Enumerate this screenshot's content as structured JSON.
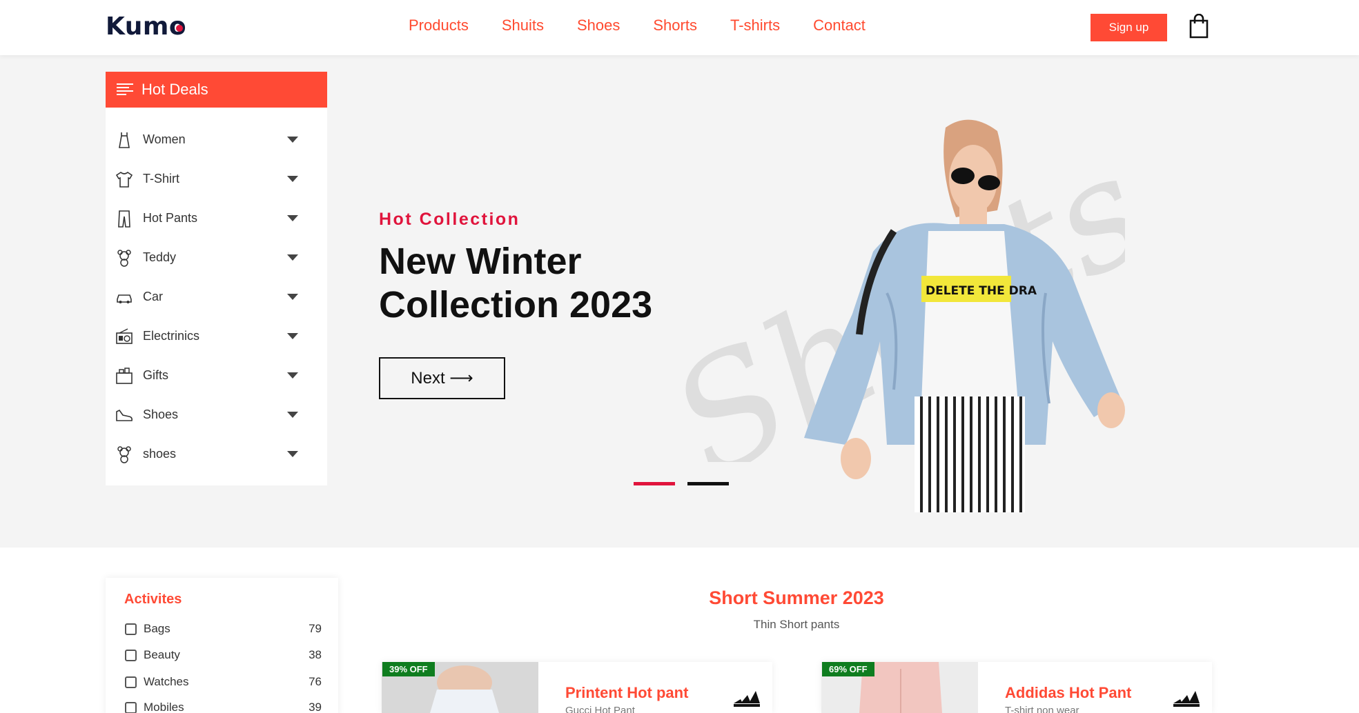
{
  "header": {
    "logo": "Kumo",
    "nav": [
      "Products",
      "Shuits",
      "Shoes",
      "Shorts",
      "T-shirts",
      "Contact"
    ],
    "signup_label": "Sign up",
    "cart_icon": "shopping-bag-icon",
    "accent_color": "#ff4a35"
  },
  "sidebar": {
    "title": "Hot Deals",
    "items": [
      {
        "label": "Women",
        "icon": "dress-icon"
      },
      {
        "label": "T-Shirt",
        "icon": "tshirt-icon"
      },
      {
        "label": "Hot Pants",
        "icon": "pants-icon"
      },
      {
        "label": "Teddy",
        "icon": "teddy-icon"
      },
      {
        "label": "Car",
        "icon": "car-icon"
      },
      {
        "label": "Electrinics",
        "icon": "radio-icon"
      },
      {
        "label": "Gifts",
        "icon": "gift-icon"
      },
      {
        "label": "Shoes",
        "icon": "shoe-icon"
      },
      {
        "label": "shoes",
        "icon": "teddy-icon"
      }
    ]
  },
  "hero": {
    "subtitle": "Hot Collection",
    "title": "New Winter Collection 2023",
    "button_label": "Next ⟶",
    "watermark": "Shorts",
    "slide_count": 2,
    "active_slide": 1
  },
  "filters": {
    "title": "Activites",
    "items": [
      {
        "label": "Bags",
        "count": "79"
      },
      {
        "label": "Beauty",
        "count": "38"
      },
      {
        "label": "Watches",
        "count": "76"
      },
      {
        "label": "Mobiles",
        "count": "39"
      }
    ]
  },
  "section": {
    "title": "Short Summer 2023",
    "subtitle": "Thin Short pants"
  },
  "products": [
    {
      "discount": "39% OFF",
      "name": "Printent Hot pant",
      "sub": "Gucci Hot Pant",
      "brand": "adidas-logo"
    },
    {
      "discount": "69% OFF",
      "name": "Addidas Hot Pant",
      "sub": "T-shirt non wear",
      "brand": "adidas-logo"
    }
  ]
}
